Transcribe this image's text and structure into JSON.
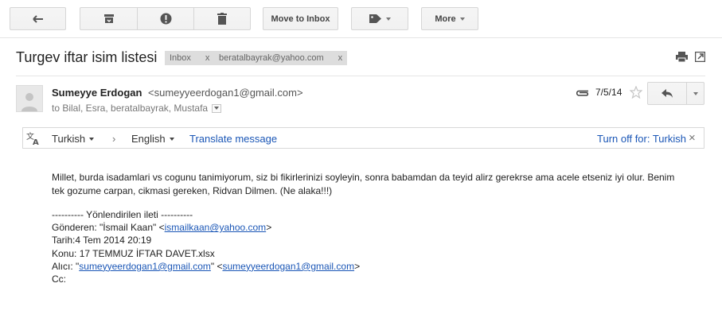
{
  "toolbar": {
    "back_icon": "back-arrow-icon",
    "archive_icon": "archive-icon",
    "spam_icon": "report-spam-icon",
    "delete_icon": "trash-icon",
    "move_to_inbox": "Move to Inbox",
    "labels_icon": "label-tag-icon",
    "more": "More"
  },
  "subject": {
    "title": "Turgev iftar isim listesi",
    "labels": [
      {
        "text": "Inbox",
        "remove": "x"
      },
      {
        "text": "beratalbayrak@yahoo.com",
        "remove": "x"
      }
    ],
    "print_icon": "print-icon",
    "new_window_icon": "open-in-new-window-icon"
  },
  "message": {
    "sender_name": "Sumeyye Erdogan",
    "sender_email": "<sumeyyeerdogan1@gmail.com>",
    "recipients": "to Bilal, Esra, beratalbayrak, Mustafa",
    "date": "7/5/14",
    "attachment_icon": "paperclip-icon",
    "star_icon": "star-outline-icon",
    "reply_icon": "reply-icon"
  },
  "translate": {
    "source_lang": "Turkish",
    "arrow": "›",
    "target_lang": "English",
    "action": "Translate message",
    "turn_off": "Turn off for: Turkish",
    "close": "×"
  },
  "body": {
    "paragraph": "Millet, burda isadamlari vs cogunu tanimiyorum, siz bi fikirlerinizi soyleyin, sonra babamdan da teyid alirz gerekrse ama acele etseniz iyi olur. Benim tek gozume carpan, cikmasi gereken, Ridvan Dilmen. (Ne alaka!!!)",
    "forward_header": "---------- Yönlendirilen ileti ----------",
    "from_prefix": "Gönderen: \"İsmail Kaan\" <",
    "from_email": "ismailkaan@yahoo.com",
    "from_suffix": ">",
    "date_line": "Tarih:4 Tem 2014 20:19",
    "subject_line": "Konu: 17 TEMMUZ İFTAR DAVET.xlsx",
    "to_prefix": "Alıcı: \"",
    "to_email1": "sumeyyeerdogan1@gmail.com",
    "to_middle": "\" <",
    "to_email2": "sumeyyeerdogan1@gmail.com",
    "to_suffix": ">",
    "cc_line": "Cc:"
  }
}
